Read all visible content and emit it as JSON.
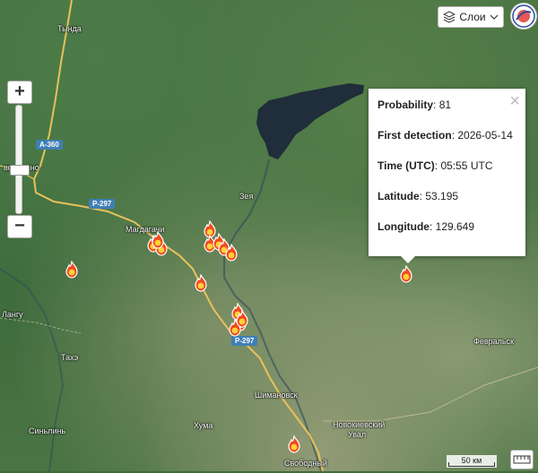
{
  "map": {
    "places": [
      {
        "id": "tynda",
        "label": "Тында"
      },
      {
        "id": "magdagachi",
        "label": "Магдагачи"
      },
      {
        "id": "zeya",
        "label": "Зея"
      },
      {
        "id": "shimanovsk",
        "label": "Шимановск"
      },
      {
        "id": "khuma",
        "label": "Хума"
      },
      {
        "id": "novokievsky",
        "label": "Новокиевский"
      },
      {
        "id": "uval",
        "label": "Увал"
      },
      {
        "id": "svobodny",
        "label": "Свободный"
      },
      {
        "id": "fevralsk",
        "label": "Февральск"
      },
      {
        "id": "tahe",
        "label": "Тахэ"
      },
      {
        "id": "sinlin",
        "label": "Синьлинь"
      },
      {
        "id": "langu",
        "label": "Лангу"
      },
      {
        "id": "skovorodino",
        "label": "вородино"
      }
    ],
    "roads": [
      {
        "id": "a360",
        "label": "А-360"
      },
      {
        "id": "r297a",
        "label": "Р-297"
      },
      {
        "id": "r297b",
        "label": "Р-297"
      }
    ],
    "fire_count": 16
  },
  "controls": {
    "zoom_in": "+",
    "zoom_out": "−",
    "layers_label": "Слои",
    "scale_label": "50 км"
  },
  "popup": {
    "probability_label": "Probability",
    "probability_value": "81",
    "first_detection_label": "First detection",
    "first_detection_value": "2026-05-14",
    "time_label": "Time (UTC)",
    "time_value": "05:55 UTC",
    "latitude_label": "Latitude",
    "latitude_value": "53.195",
    "longitude_label": "Longitude",
    "longitude_value": "129.649",
    "close_symbol": "×"
  },
  "colors": {
    "road_shield": "#3f7fb5",
    "highway": "#e8c15a",
    "water": "#1c2a3a",
    "fire_outer": "#f24a1d",
    "fire_inner": "#ffd23a"
  }
}
